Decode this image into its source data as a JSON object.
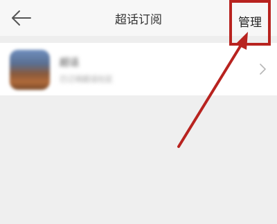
{
  "header": {
    "title": "超话订阅",
    "manage_label": "管理"
  },
  "list": {
    "items": [
      {
        "name": "超话",
        "subtitle": "已订阅超话社区"
      }
    ]
  },
  "annotation": {
    "color": "#b8231f"
  },
  "icons": {
    "back": "back-arrow-icon",
    "chevron": "chevron-right-icon"
  }
}
